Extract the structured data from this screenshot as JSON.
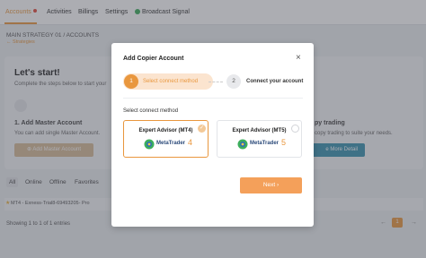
{
  "nav": {
    "tabs": [
      {
        "label": "Accounts"
      },
      {
        "label": "Activities"
      },
      {
        "label": "Billings"
      },
      {
        "label": "Settings"
      },
      {
        "label": "Broadcast Signal"
      }
    ]
  },
  "breadcrumb": "MAIN STRATEGY 01 / ACCOUNTS",
  "back_link": "← Strategies",
  "start_card": {
    "title": "Let's start!",
    "subtitle": "Complete the steps below to start your",
    "step_number": "1.",
    "step_title": "1. Add Master Account",
    "step_desc": "You can add single Master Account.",
    "add_button": "⊕ Add Master Account",
    "copy_title": "py trading",
    "copy_desc": "copy trading to suite your needs.",
    "more_button": "e More Detail"
  },
  "filters": [
    {
      "label": "All"
    },
    {
      "label": "Online"
    },
    {
      "label": "Offline"
    },
    {
      "label": "Favorites"
    }
  ],
  "table": {
    "row_text": "MT4 - Exness-Trial8-69493205- Pro"
  },
  "pagination": {
    "summary": "Showing 1 to 1 of 1 entries",
    "prev": "←",
    "current": "1",
    "next": "→"
  },
  "modal": {
    "title": "Add Copier Account",
    "close": "×",
    "steps": [
      {
        "number": "1",
        "label": "Select connect method"
      },
      {
        "number": "2",
        "label": "Connect your account"
      }
    ],
    "section_label": "Select connect method",
    "options": [
      {
        "name": "Expert Advisor (MT4)",
        "brand": "MetaTrader",
        "version": "4",
        "selected": true
      },
      {
        "name": "Expert Advisor (MT5)",
        "brand": "MetaTrader",
        "version": "5",
        "selected": false
      }
    ],
    "next_button": "Next ›"
  },
  "colors": {
    "accent": "#e9973e",
    "overlay": "#464a54",
    "success": "#3cae5c",
    "info": "#3a92b0"
  }
}
